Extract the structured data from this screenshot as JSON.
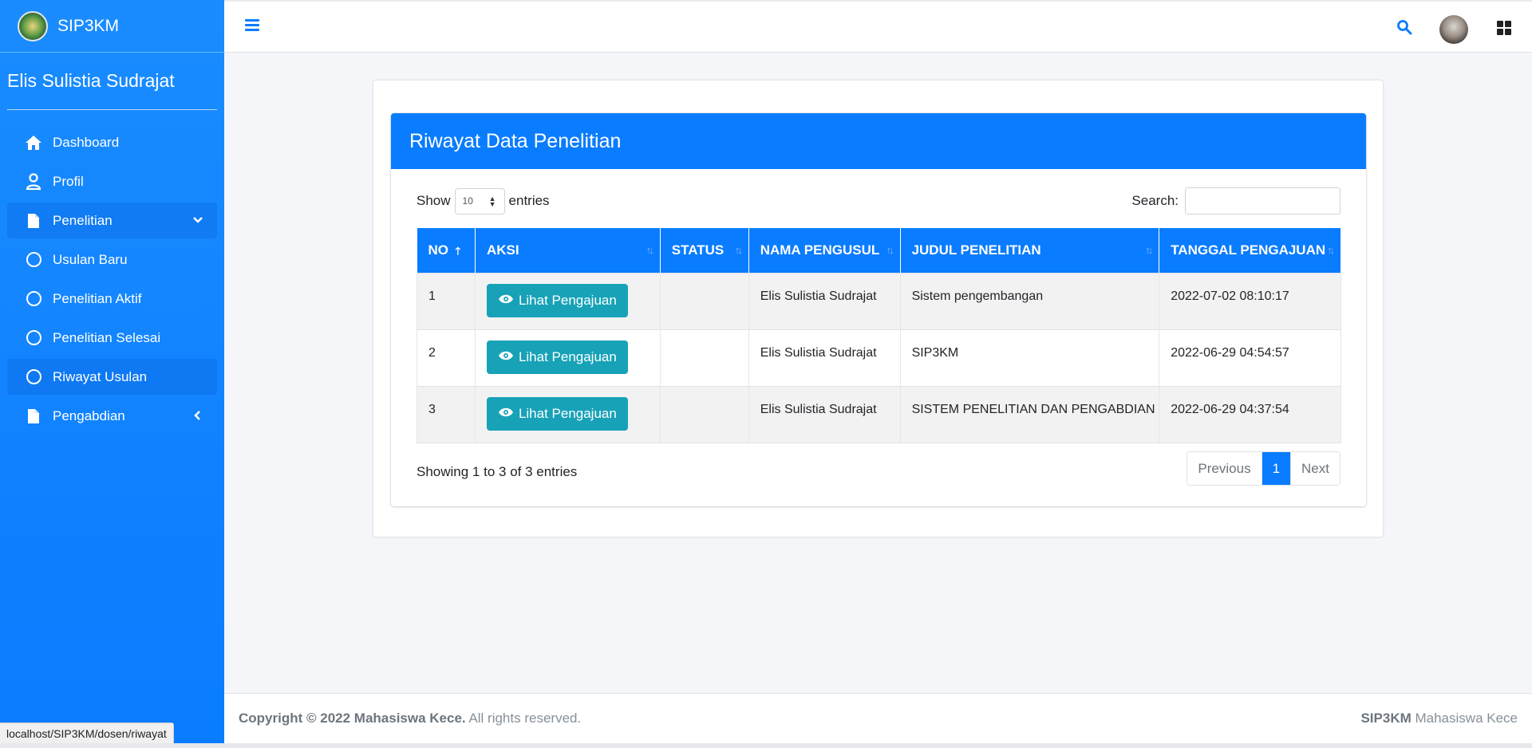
{
  "brand": {
    "name": "SIP3KM"
  },
  "user": {
    "name": "Elis Sulistia Sudrajat"
  },
  "sidebar": {
    "items": [
      {
        "label": "Dashboard",
        "icon": "home-icon"
      },
      {
        "label": "Profil",
        "icon": "user-icon"
      },
      {
        "label": "Penelitian",
        "icon": "file-icon",
        "expanded": true
      },
      {
        "label": "Usulan Baru",
        "icon": "circle-icon"
      },
      {
        "label": "Penelitian Aktif",
        "icon": "circle-icon"
      },
      {
        "label": "Penelitian Selesai",
        "icon": "circle-icon"
      },
      {
        "label": "Riwayat Usulan",
        "icon": "circle-icon",
        "active": true
      },
      {
        "label": "Pengabdian",
        "icon": "file-icon",
        "expanded": false
      }
    ]
  },
  "card": {
    "title": "Riwayat Data Penelitian"
  },
  "table_controls": {
    "show_label": "Show",
    "entries_value": "10",
    "entries_label": "entries",
    "search_label": "Search:"
  },
  "table": {
    "columns": [
      "NO",
      "AKSI",
      "STATUS",
      "NAMA PENGUSUL",
      "JUDUL PENELITIAN",
      "TANGGAL PENGAJUAN"
    ],
    "action_label": "Lihat Pengajuan",
    "rows": [
      {
        "no": "1",
        "status": "",
        "nama": "Elis Sulistia Sudrajat",
        "judul": "Sistem pengembangan",
        "tanggal": "2022-07-02 08:10:17"
      },
      {
        "no": "2",
        "status": "",
        "nama": "Elis Sulistia Sudrajat",
        "judul": "SIP3KM",
        "tanggal": "2022-06-29 04:54:57"
      },
      {
        "no": "3",
        "status": "",
        "nama": "Elis Sulistia Sudrajat",
        "judul": "SISTEM PENELITIAN DAN PENGABDIAN",
        "tanggal": "2022-06-29 04:37:54"
      }
    ]
  },
  "info": "Showing 1 to 3 of 3 entries",
  "pagination": {
    "previous": "Previous",
    "current": "1",
    "next": "Next"
  },
  "footer": {
    "copyright_bold": "Copyright © 2022 Mahasiswa Kece.",
    "copyright_rest": " All rights reserved.",
    "right_bold": "SIP3KM",
    "right_rest": " Mahasiswa Kece"
  },
  "status_bar": {
    "url": "localhost/SIP3KM/dosen/riwayat"
  },
  "colors": {
    "primary": "#0a7cff",
    "action": "#17a2b8"
  }
}
